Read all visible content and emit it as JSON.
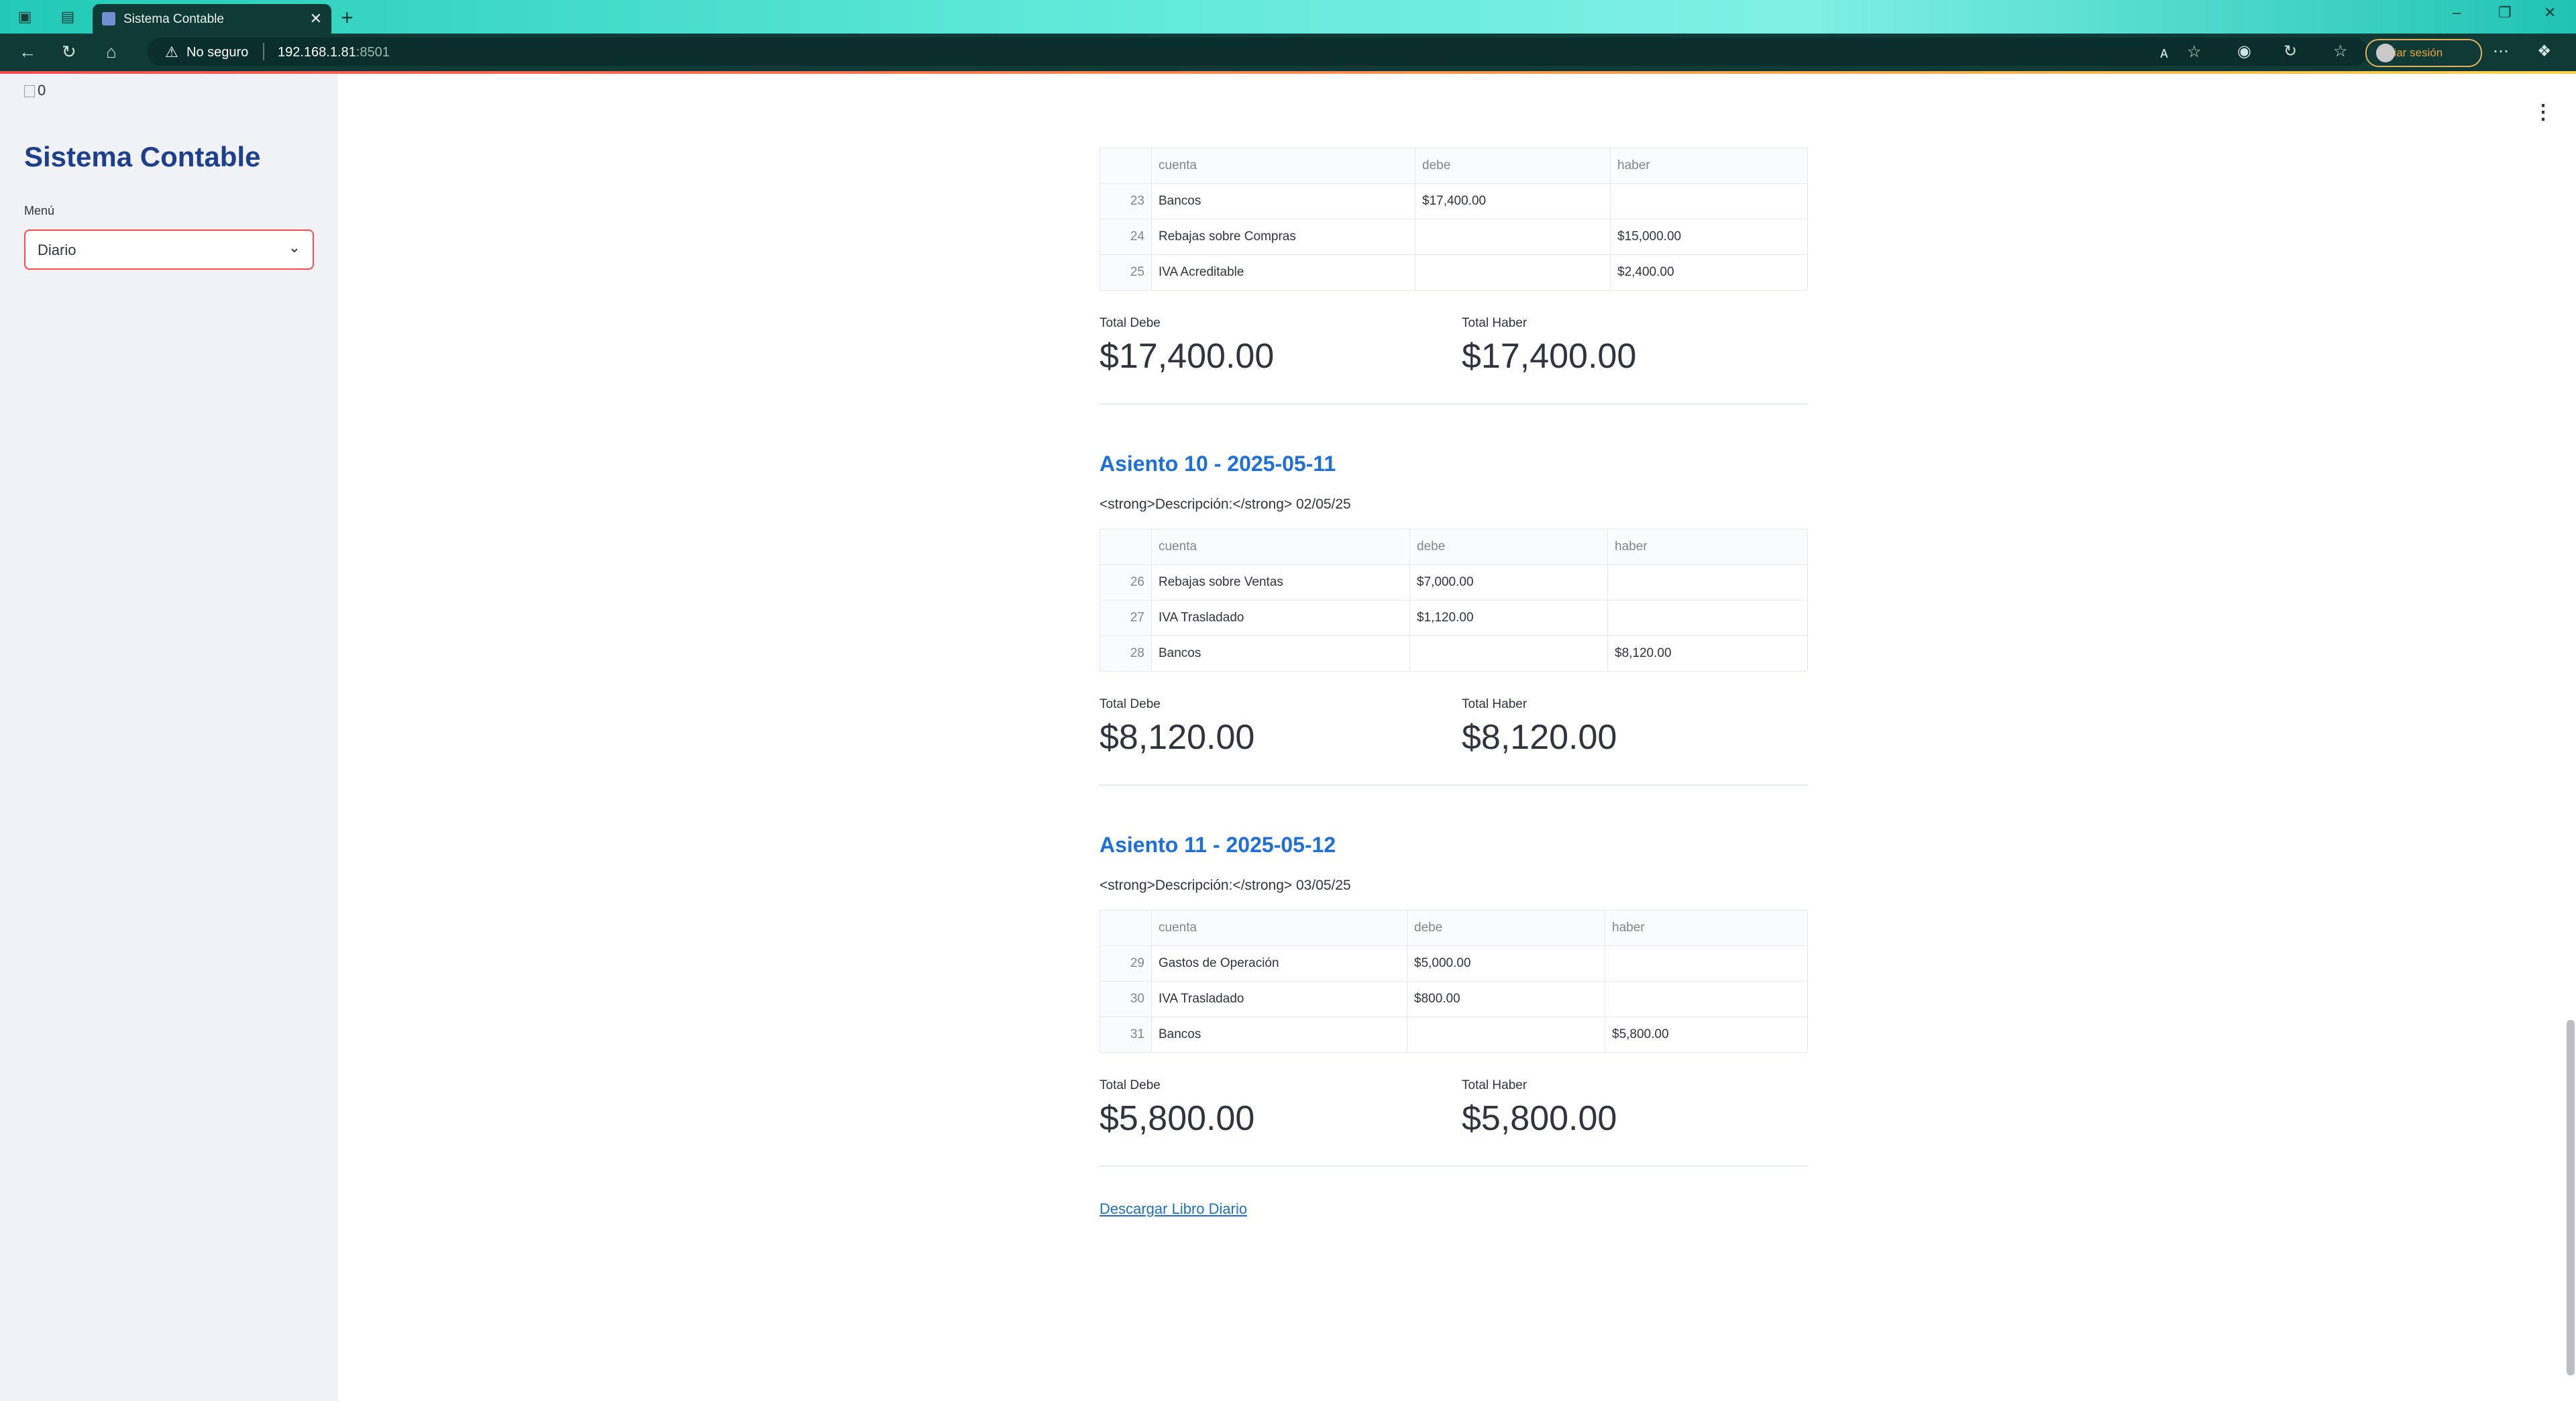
{
  "browser": {
    "tab_title": "Sistema Contable",
    "security_label": "No seguro",
    "url_host": "192.168.1.81",
    "url_port": ":8501",
    "signin_label": "Iniciar sesión"
  },
  "sidebar": {
    "image_alt": "0",
    "title": "Sistema Contable",
    "menu_label": "Menú",
    "menu_value": "Diario"
  },
  "columns": {
    "cuenta": "cuenta",
    "debe": "debe",
    "haber": "haber"
  },
  "totals_labels": {
    "debe": "Total Debe",
    "haber": "Total Haber"
  },
  "entries": [
    {
      "rows": [
        {
          "idx": "23",
          "cuenta": "Bancos",
          "debe": "$17,400.00",
          "haber": ""
        },
        {
          "idx": "24",
          "cuenta": "Rebajas sobre Compras",
          "debe": "",
          "haber": "$15,000.00"
        },
        {
          "idx": "25",
          "cuenta": "IVA Acreditable",
          "debe": "",
          "haber": "$2,400.00"
        }
      ],
      "total_debe": "$17,400.00",
      "total_haber": "$17,400.00"
    },
    {
      "title": "Asiento 10 - 2025-05-11",
      "description": "<strong>Descripción:</strong> 02/05/25",
      "rows": [
        {
          "idx": "26",
          "cuenta": "Rebajas sobre Ventas",
          "debe": "$7,000.00",
          "haber": ""
        },
        {
          "idx": "27",
          "cuenta": "IVA Trasladado",
          "debe": "$1,120.00",
          "haber": ""
        },
        {
          "idx": "28",
          "cuenta": "Bancos",
          "debe": "",
          "haber": "$8,120.00"
        }
      ],
      "total_debe": "$8,120.00",
      "total_haber": "$8,120.00"
    },
    {
      "title": "Asiento 11 - 2025-05-12",
      "description": "<strong>Descripción:</strong> 03/05/25",
      "rows": [
        {
          "idx": "29",
          "cuenta": "Gastos de Operación",
          "debe": "$5,000.00",
          "haber": ""
        },
        {
          "idx": "30",
          "cuenta": "IVA Trasladado",
          "debe": "$800.00",
          "haber": ""
        },
        {
          "idx": "31",
          "cuenta": "Bancos",
          "debe": "",
          "haber": "$5,800.00"
        }
      ],
      "total_debe": "$5,800.00",
      "total_haber": "$5,800.00"
    }
  ],
  "download_label": "Descargar Libro Diario",
  "colors": {
    "accent": "#ff4b4b",
    "title_blue": "#1e6fd9",
    "sidebar_title": "#1c3f8f"
  }
}
